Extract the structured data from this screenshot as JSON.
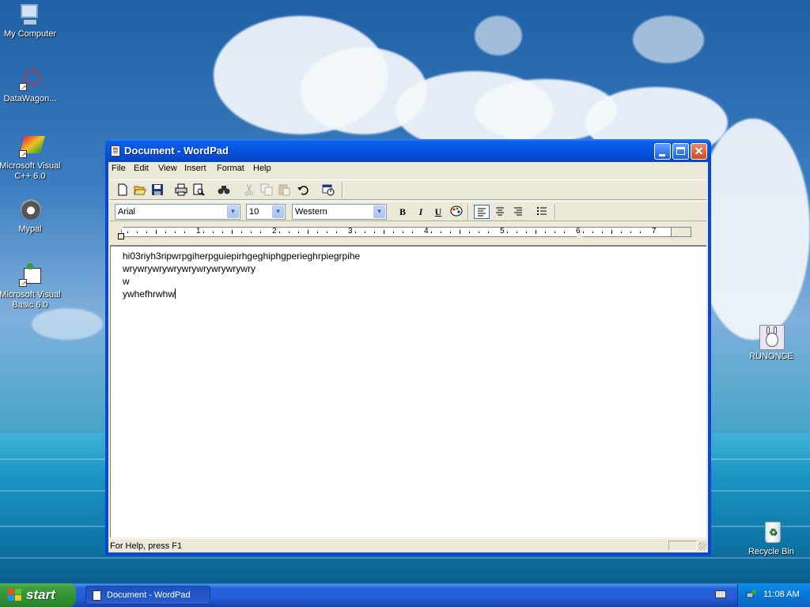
{
  "desktop": {
    "icons": [
      {
        "label": "My Computer",
        "icon": "my-computer-icon"
      },
      {
        "label": "DataWagon...",
        "icon": "datawagon-icon"
      },
      {
        "label": "Microsoft Visual C++ 6.0",
        "icon": "visual-cpp-icon"
      },
      {
        "label": "Mypal",
        "icon": "mypal-icon"
      },
      {
        "label": "Microsoft Visual Basic 6.0",
        "icon": "visual-basic-icon"
      },
      {
        "label": "RUNONCE",
        "icon": "runonce-icon"
      },
      {
        "label": "Recycle Bin",
        "icon": "recycle-bin-icon"
      }
    ]
  },
  "window": {
    "title": "Document - WordPad",
    "minimize": "_",
    "maximize": "□",
    "close": "✕"
  },
  "menu": {
    "items": [
      "File",
      "Edit",
      "View",
      "Insert",
      "Format",
      "Help"
    ]
  },
  "format_bar": {
    "font": "Arial",
    "size": "10",
    "script": "Western",
    "bold": "B",
    "italic": "I",
    "underline": "U"
  },
  "ruler": {
    "numbers": [
      "1",
      "2",
      "3",
      "4",
      "5",
      "6",
      "7"
    ]
  },
  "document": {
    "lines": [
      "hi03riyh3ripwrpgiherpguiepirhgeghiphgperieghrpiegrpihe",
      "wrywrywrywrywrywrywrywrywry",
      "w",
      "ywhefhrwhw"
    ]
  },
  "status": {
    "help_text": "For Help, press F1"
  },
  "taskbar": {
    "start_label": "start",
    "task_label": "Document - WordPad",
    "clock": "11:08 AM"
  },
  "colors": {
    "title_blue": "#0454e0",
    "taskbar_blue": "#245edb",
    "start_green": "#3c9e3e",
    "close_red": "#d04a20"
  }
}
